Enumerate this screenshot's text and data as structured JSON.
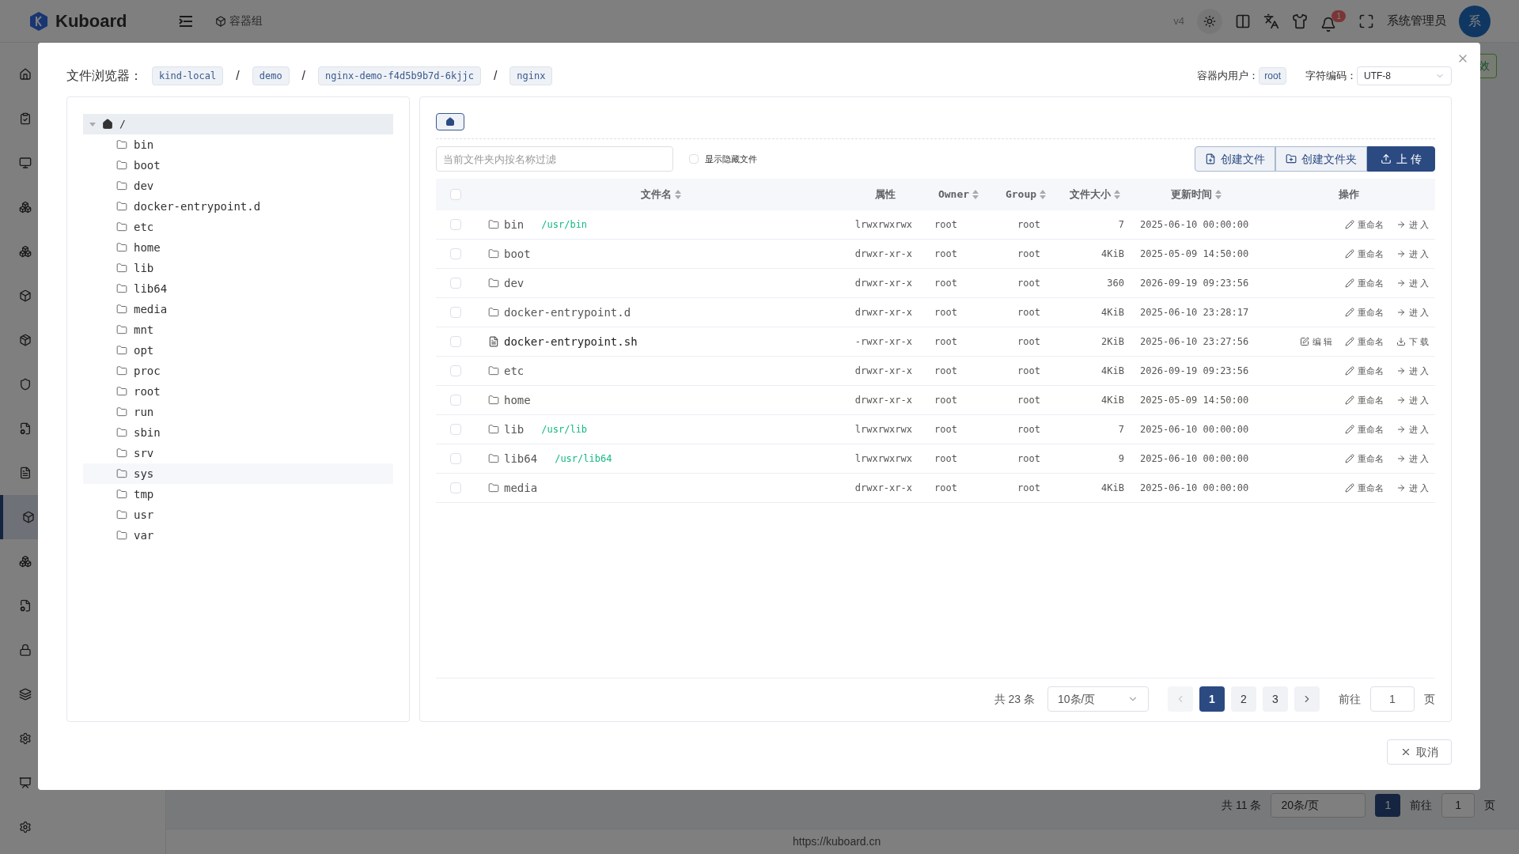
{
  "app": {
    "logo": "Kuboard",
    "breadcrumb": "容器组",
    "version": "v4",
    "notifications": "1",
    "user": "系统管理员",
    "avatar": "系",
    "bg_button": "效",
    "footer": "https://kuboard.cn",
    "bg_pagination": {
      "total": "共 11 条",
      "page_size": "20条/页",
      "page": "1",
      "goto_label": "前往",
      "goto_value": "1",
      "unit": "页"
    }
  },
  "dialog": {
    "title": "文件浏览器：",
    "path": [
      "kind-local",
      "demo",
      "nginx-demo-f4d5b9b7d-6kjjc",
      "nginx"
    ],
    "path_separator": "/",
    "container_user_label": "容器内用户：",
    "container_user": "root",
    "encoding_label": "字符编码：",
    "encoding": "UTF-8",
    "tree": {
      "label": "/",
      "expanded": true,
      "selected": true,
      "children": [
        {
          "label": "bin",
          "hovered": false
        },
        {
          "label": "boot",
          "hovered": false
        },
        {
          "label": "dev",
          "hovered": false
        },
        {
          "label": "docker-entrypoint.d",
          "hovered": false
        },
        {
          "label": "etc",
          "hovered": false
        },
        {
          "label": "home",
          "hovered": false
        },
        {
          "label": "lib",
          "hovered": false
        },
        {
          "label": "lib64",
          "hovered": false
        },
        {
          "label": "media",
          "hovered": false
        },
        {
          "label": "mnt",
          "hovered": false
        },
        {
          "label": "opt",
          "hovered": false
        },
        {
          "label": "proc",
          "hovered": false
        },
        {
          "label": "root",
          "hovered": false
        },
        {
          "label": "run",
          "hovered": false
        },
        {
          "label": "sbin",
          "hovered": false
        },
        {
          "label": "srv",
          "hovered": false
        },
        {
          "label": "sys",
          "hovered": true
        },
        {
          "label": "tmp",
          "hovered": false
        },
        {
          "label": "usr",
          "hovered": false
        },
        {
          "label": "var",
          "hovered": false
        }
      ]
    },
    "filter": {
      "placeholder": "当前文件夹内按名称过滤"
    },
    "all_checked": false,
    "show_hidden": {
      "label": "显示隐藏文件",
      "checked": false
    },
    "buttons": [
      {
        "kind": "new-file",
        "label": "创建文件",
        "primary": false
      },
      {
        "kind": "new-folder",
        "label": "创建文件夹",
        "primary": false
      },
      {
        "kind": "upload",
        "label": "上 传",
        "primary": true
      }
    ],
    "columns": [
      {
        "label": "文件名",
        "sortable": true
      },
      {
        "label": "属性",
        "sortable": false
      },
      {
        "label": "Owner",
        "sortable": true
      },
      {
        "label": "Group",
        "sortable": true
      },
      {
        "label": "文件大小",
        "sortable": true
      },
      {
        "label": "更新时间",
        "sortable": true
      },
      {
        "label": "操作",
        "sortable": false
      }
    ],
    "rows": [
      {
        "kind": "folder",
        "name": "bin",
        "link": "/usr/bin",
        "attrs": "lrwxrwxrwx",
        "owner": "root",
        "group": "root",
        "size": "7",
        "mtime": "2025-06-10 00:00:00",
        "checked": false,
        "actions": [
          {
            "kind": "rename",
            "label": "重命名"
          },
          {
            "kind": "enter",
            "label": "进 入"
          }
        ]
      },
      {
        "kind": "folder",
        "name": "boot",
        "attrs": "drwxr-xr-x",
        "owner": "root",
        "group": "root",
        "size": "4KiB",
        "mtime": "2025-05-09 14:50:00",
        "checked": false,
        "actions": [
          {
            "kind": "rename",
            "label": "重命名"
          },
          {
            "kind": "enter",
            "label": "进 入"
          }
        ]
      },
      {
        "kind": "folder",
        "name": "dev",
        "attrs": "drwxr-xr-x",
        "owner": "root",
        "group": "root",
        "size": "360",
        "mtime": "2026-09-19 09:23:56",
        "checked": false,
        "actions": [
          {
            "kind": "rename",
            "label": "重命名"
          },
          {
            "kind": "enter",
            "label": "进 入"
          }
        ]
      },
      {
        "kind": "folder",
        "name": "docker-entrypoint.d",
        "attrs": "drwxr-xr-x",
        "owner": "root",
        "group": "root",
        "size": "4KiB",
        "mtime": "2025-06-10 23:28:17",
        "checked": false,
        "actions": [
          {
            "kind": "rename",
            "label": "重命名"
          },
          {
            "kind": "enter",
            "label": "进 入"
          }
        ]
      },
      {
        "kind": "file",
        "name": "docker-entrypoint.sh",
        "attrs": "-rwxr-xr-x",
        "owner": "root",
        "group": "root",
        "size": "2KiB",
        "mtime": "2025-06-10 23:27:56",
        "checked": false,
        "actions": [
          {
            "kind": "edit",
            "label": "编 辑"
          },
          {
            "kind": "rename",
            "label": "重命名"
          },
          {
            "kind": "download",
            "label": "下 载"
          }
        ]
      },
      {
        "kind": "folder",
        "name": "etc",
        "attrs": "drwxr-xr-x",
        "owner": "root",
        "group": "root",
        "size": "4KiB",
        "mtime": "2026-09-19 09:23:56",
        "checked": false,
        "actions": [
          {
            "kind": "rename",
            "label": "重命名"
          },
          {
            "kind": "enter",
            "label": "进 入"
          }
        ]
      },
      {
        "kind": "folder",
        "name": "home",
        "attrs": "drwxr-xr-x",
        "owner": "root",
        "group": "root",
        "size": "4KiB",
        "mtime": "2025-05-09 14:50:00",
        "checked": false,
        "actions": [
          {
            "kind": "rename",
            "label": "重命名"
          },
          {
            "kind": "enter",
            "label": "进 入"
          }
        ]
      },
      {
        "kind": "folder",
        "name": "lib",
        "link": "/usr/lib",
        "attrs": "lrwxrwxrwx",
        "owner": "root",
        "group": "root",
        "size": "7",
        "mtime": "2025-06-10 00:00:00",
        "checked": false,
        "actions": [
          {
            "kind": "rename",
            "label": "重命名"
          },
          {
            "kind": "enter",
            "label": "进 入"
          }
        ]
      },
      {
        "kind": "folder",
        "name": "lib64",
        "link": "/usr/lib64",
        "attrs": "lrwxrwxrwx",
        "owner": "root",
        "group": "root",
        "size": "9",
        "mtime": "2025-06-10 00:00:00",
        "checked": false,
        "actions": [
          {
            "kind": "rename",
            "label": "重命名"
          },
          {
            "kind": "enter",
            "label": "进 入"
          }
        ]
      },
      {
        "kind": "folder",
        "name": "media",
        "attrs": "drwxr-xr-x",
        "owner": "root",
        "group": "root",
        "size": "4KiB",
        "mtime": "2025-06-10 00:00:00",
        "checked": false,
        "actions": [
          {
            "kind": "rename",
            "label": "重命名"
          },
          {
            "kind": "enter",
            "label": "进 入"
          }
        ]
      }
    ],
    "pagination": {
      "total": "共 23 条",
      "page_size": "10条/页",
      "pages": [
        {
          "label": "1",
          "selected": true
        },
        {
          "label": "2",
          "selected": false
        },
        {
          "label": "3",
          "selected": false
        }
      ],
      "goto_label": "前往",
      "goto_value": "1",
      "unit": "页"
    },
    "cancel": "取消"
  }
}
